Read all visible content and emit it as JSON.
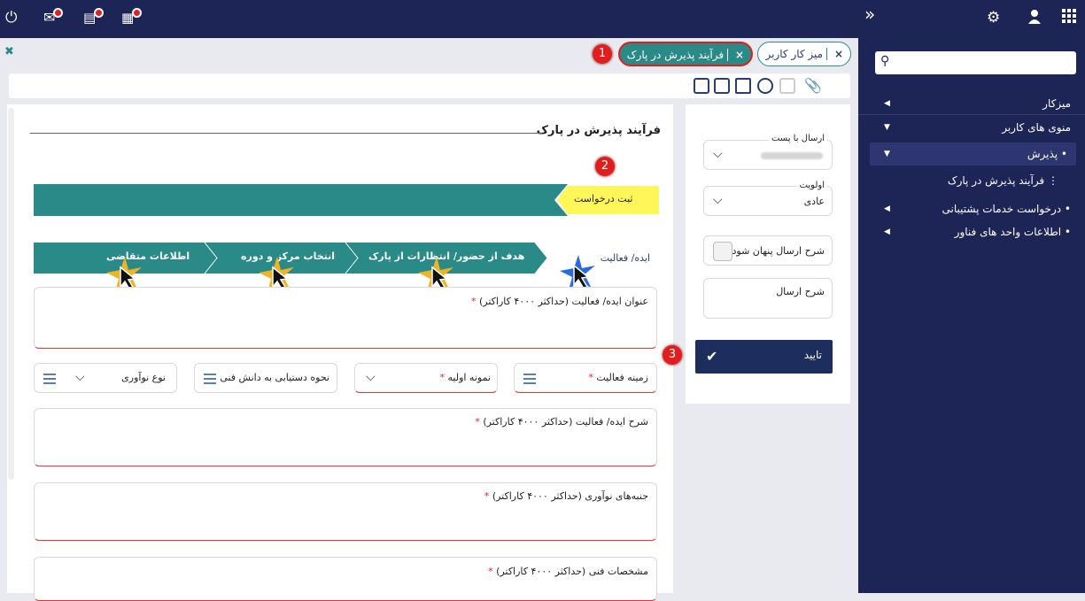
{
  "colors": {
    "navy": "#1d2456",
    "teal": "#2a8a88",
    "step_active": "#fff75a",
    "accent_red": "#e21d1d"
  },
  "topbar": {
    "icons": [
      "power-icon",
      "mail-icon",
      "document-icon",
      "calendar-icon"
    ],
    "right_icons": [
      "collapse-icon",
      "gear-icon",
      "user-icon",
      "apps-grid-icon"
    ]
  },
  "tabs": {
    "active": "فرآیند پذیرش در پارک",
    "second": "میز کار کاربر",
    "close_glyph": "×"
  },
  "form": {
    "title": "فرآیند پذیرش در پارک",
    "step_top": "ثبت درخواست",
    "steps": [
      "ایده/ فعالیت",
      "هدف از حضور/ انتظارات از پارک",
      "انتخاب مرکز و دوره",
      "اطلاعات متقاضی"
    ],
    "fields": {
      "idea_title": "عنوان ایده/ فعالیت (حداکثر ۴۰۰۰ کاراکتر)",
      "activity_field": "زمینه فعالیت",
      "prototype": "نمونه اولیه",
      "access_method": "نحوه دستیابی به دانش فنی",
      "innovation_type": "نوع نوآوری",
      "idea_description": "شرح ایده/ فعالیت (حداکثر ۴۰۰۰ کاراکتر)",
      "innovation_aspects": "جنبه‌های نوآوری (حداکثر ۴۰۰۰ کاراکتر)",
      "technical_specs": "مشخصات فنی (حداکثر ۴۰۰۰ کاراکتر)"
    },
    "required_mark": "*"
  },
  "right": {
    "send_label": "ارسال با پست",
    "send_value": "",
    "priority_label": "اولویت",
    "priority_value": "عادی",
    "hide_toggle": "شرح ارسال پنهان شود",
    "desc_label": "شرح ارسال",
    "confirm": "تایید"
  },
  "sidebar": {
    "search_placeholder": "",
    "items": [
      {
        "label": "میزکار"
      },
      {
        "label": "منوی های کاربر"
      },
      {
        "label": "پذیرش"
      },
      {
        "label": "فرآیند پذیرش در پارک"
      },
      {
        "label": "درخواست خدمات پشتیبانی"
      },
      {
        "label": "اطلاعات واحد های فناور"
      }
    ]
  },
  "badges": [
    "1",
    "2",
    "3"
  ]
}
